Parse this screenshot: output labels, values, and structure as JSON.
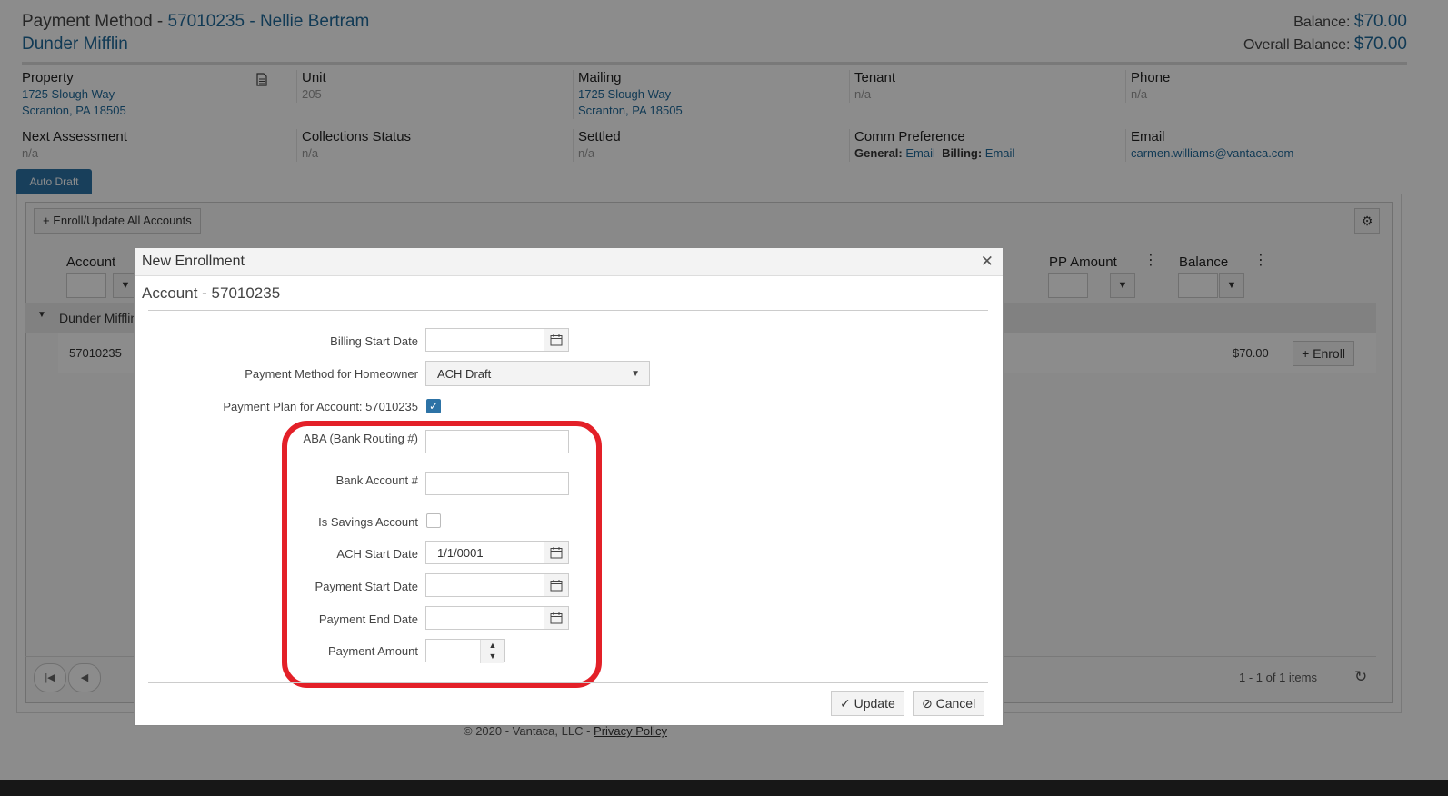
{
  "header": {
    "title_prefix": "Payment Method - ",
    "title_link": "57010235 - Nellie Bertram",
    "subtitle": "Dunder Mifflin",
    "balance_label": "Balance: ",
    "balance_value": "$70.00",
    "overall_label": "Overall Balance: ",
    "overall_value": "$70.00"
  },
  "info": {
    "property": {
      "label": "Property",
      "line1": "1725 Slough Way",
      "line2": "Scranton, PA 18505"
    },
    "unit": {
      "label": "Unit",
      "value": "205"
    },
    "mailing": {
      "label": "Mailing",
      "line1": "1725 Slough Way",
      "line2": "Scranton, PA 18505"
    },
    "tenant": {
      "label": "Tenant",
      "value": "n/a"
    },
    "phone": {
      "label": "Phone",
      "value": "n/a"
    },
    "next_assessment": {
      "label": "Next Assessment",
      "value": "n/a"
    },
    "collections_status": {
      "label": "Collections Status",
      "value": "n/a"
    },
    "settled": {
      "label": "Settled",
      "value": "n/a"
    },
    "comm_preference": {
      "label": "Comm Preference",
      "general_label": "General:",
      "general_value": "Email",
      "billing_label": "Billing:",
      "billing_value": "Email"
    },
    "email": {
      "label": "Email",
      "value": "carmen.williams@vantaca.com"
    }
  },
  "tab": {
    "label": "Auto Draft"
  },
  "grid": {
    "enroll_all_label": "Enroll/Update All Accounts",
    "columns": {
      "account": "Account",
      "pp_amount": "PP Amount",
      "balance": "Balance"
    },
    "group_label": "Dunder Mifflin",
    "row": {
      "account": "57010235",
      "balance": "$70.00",
      "enroll_label": "Enroll"
    },
    "pager_info": "1 - 1 of 1 items"
  },
  "footer": {
    "copyright": "© 2020 - Vantaca, LLC - ",
    "privacy": "Privacy Policy"
  },
  "modal": {
    "title": "New Enrollment",
    "subtitle": "Account - 57010235",
    "fields": {
      "billing_start_date": {
        "label": "Billing Start Date",
        "value": ""
      },
      "payment_method": {
        "label": "Payment Method for Homeowner",
        "value": "ACH Draft"
      },
      "payment_plan": {
        "label": "Payment Plan for Account: 57010235",
        "checked": true
      },
      "aba": {
        "label": "ABA (Bank Routing #)",
        "value": ""
      },
      "bank_account": {
        "label": "Bank Account #",
        "value": ""
      },
      "is_savings": {
        "label": "Is Savings Account",
        "checked": false
      },
      "ach_start_date": {
        "label": "ACH Start Date",
        "value": "1/1/0001"
      },
      "payment_start_date": {
        "label": "Payment Start Date",
        "value": ""
      },
      "payment_end_date": {
        "label": "Payment End Date",
        "value": ""
      },
      "payment_amount": {
        "label": "Payment Amount",
        "value": ""
      }
    },
    "update_label": "Update",
    "cancel_label": "Cancel"
  },
  "colors": {
    "accent": "#2d73a6",
    "link": "#1f6a9b",
    "highlight": "#e32028"
  }
}
